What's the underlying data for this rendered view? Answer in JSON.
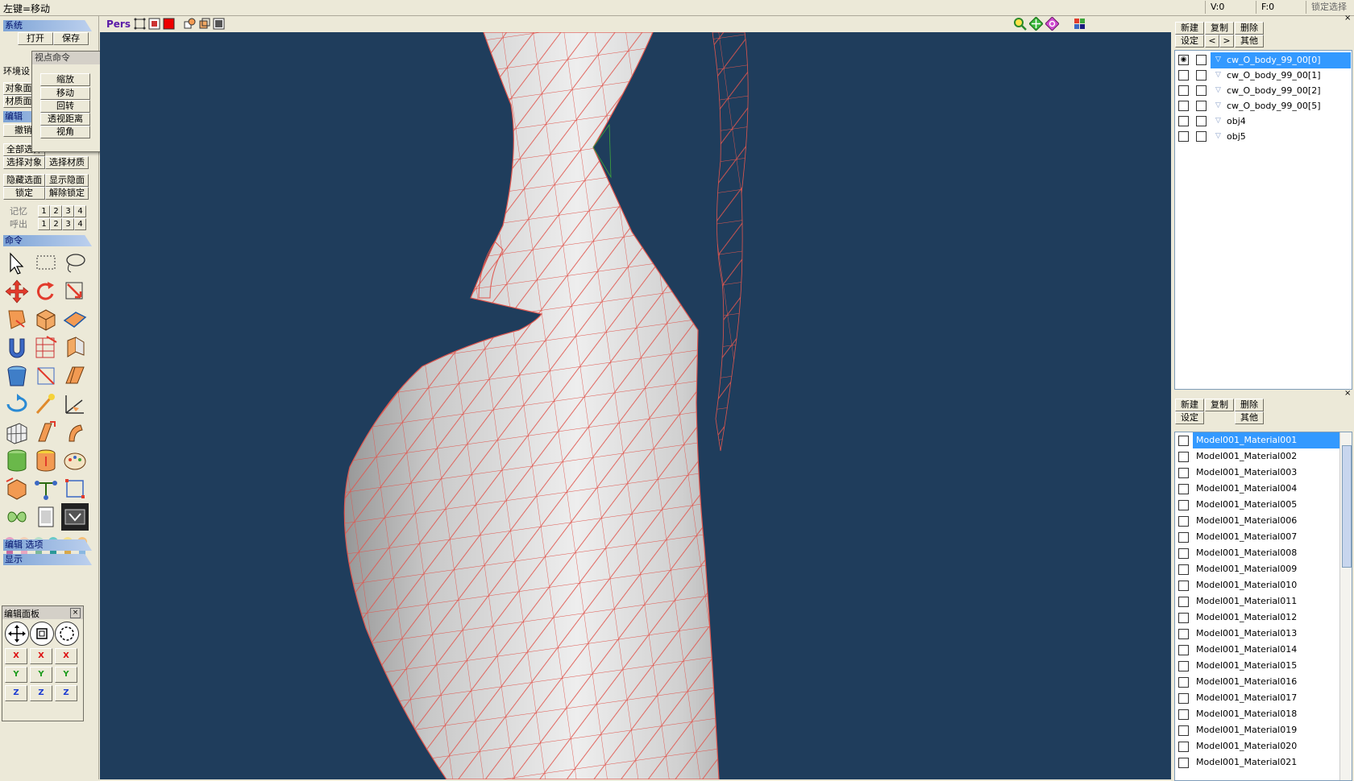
{
  "status": {
    "text": "左键=移动",
    "v": "V:0",
    "f": "F:0",
    "lock": "锁定选择"
  },
  "left": {
    "system": "系统",
    "open": "打开",
    "save": "保存",
    "env": "环境设",
    "obj_short": "对象面",
    "mat_short": "材质面",
    "edit": "编辑",
    "undo": "撤销",
    "select_all": "全部选择",
    "select_object": "选择对象",
    "select_material": "选择材质",
    "hide_selected": "隐藏选面",
    "show_hidden": "显示隐面",
    "lock": "锁定",
    "unlock": "解除锁定",
    "memory": "记忆",
    "recall": "呼出",
    "numbers": [
      "1",
      "2",
      "3",
      "4"
    ],
    "command": "命令",
    "edit_options": "编辑 选项",
    "display": "显示",
    "edit_panel": "编辑面板",
    "axis_x": "X",
    "axis_y": "Y",
    "axis_z": "Z"
  },
  "popup": {
    "title": "视点命令",
    "items": [
      "缩放",
      "移动",
      "回转",
      "透视距离",
      "视角"
    ]
  },
  "viewport": {
    "mode": "Pers",
    "bg_color": "#1f3d5c",
    "wire_color": "#e0564e"
  },
  "objects": {
    "new": "新建",
    "copy": "复制",
    "delete": "删除",
    "settings": "设定",
    "prev": "<",
    "next": ">",
    "other": "其他",
    "items": [
      "cw_O_body_99_00[0]",
      "cw_O_body_99_00[1]",
      "cw_O_body_99_00[2]",
      "cw_O_body_99_00[5]",
      "obj4",
      "obj5"
    ],
    "selected": 0
  },
  "materials": {
    "new": "新建",
    "copy": "复制",
    "delete": "删除",
    "settings": "设定",
    "other": "其他",
    "items": [
      "Model001_Material001",
      "Model001_Material002",
      "Model001_Material003",
      "Model001_Material004",
      "Model001_Material005",
      "Model001_Material006",
      "Model001_Material007",
      "Model001_Material008",
      "Model001_Material009",
      "Model001_Material010",
      "Model001_Material011",
      "Model001_Material012",
      "Model001_Material013",
      "Model001_Material014",
      "Model001_Material015",
      "Model001_Material016",
      "Model001_Material017",
      "Model001_Material018",
      "Model001_Material019",
      "Model001_Material020",
      "Model001_Material021"
    ],
    "selected": 0
  }
}
